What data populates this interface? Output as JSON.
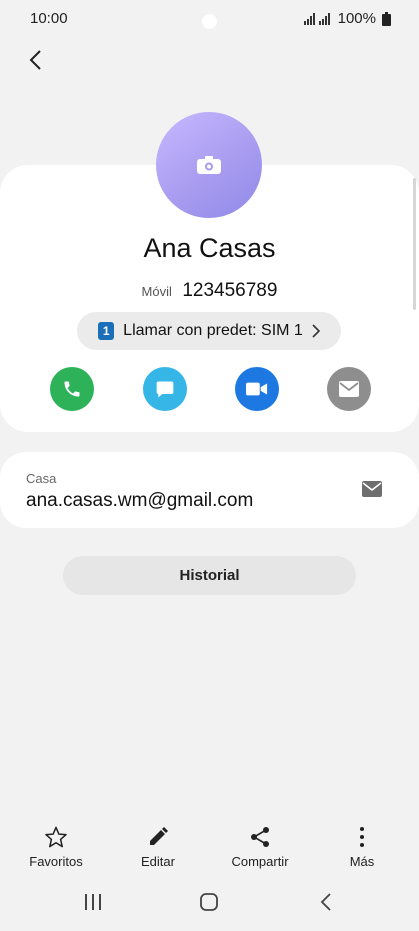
{
  "status_bar": {
    "time": "10:00",
    "battery": "100%",
    "icons": [
      "wifi-signal-icon",
      "cell-signal-icon",
      "battery-icon"
    ]
  },
  "contact": {
    "name": "Ana Casas",
    "phone_label": "Móvil",
    "phone_number": "123456789",
    "sim_badge": "1",
    "sim_text": "Llamar con predet: SIM 1"
  },
  "actions": [
    {
      "name": "call",
      "icon": "phone-icon",
      "color": "#2db25a"
    },
    {
      "name": "message",
      "icon": "message-icon",
      "color": "#35b6e6"
    },
    {
      "name": "video",
      "icon": "video-icon",
      "color": "#1e78e2"
    },
    {
      "name": "email",
      "icon": "mail-icon",
      "color": "#8e8e8e"
    }
  ],
  "email": {
    "label": "Casa",
    "value": "ana.casas.wm@gmail.com"
  },
  "history_button": "Historial",
  "toolbar": {
    "favorites": "Favoritos",
    "edit": "Editar",
    "share": "Compartir",
    "more": "Más"
  }
}
